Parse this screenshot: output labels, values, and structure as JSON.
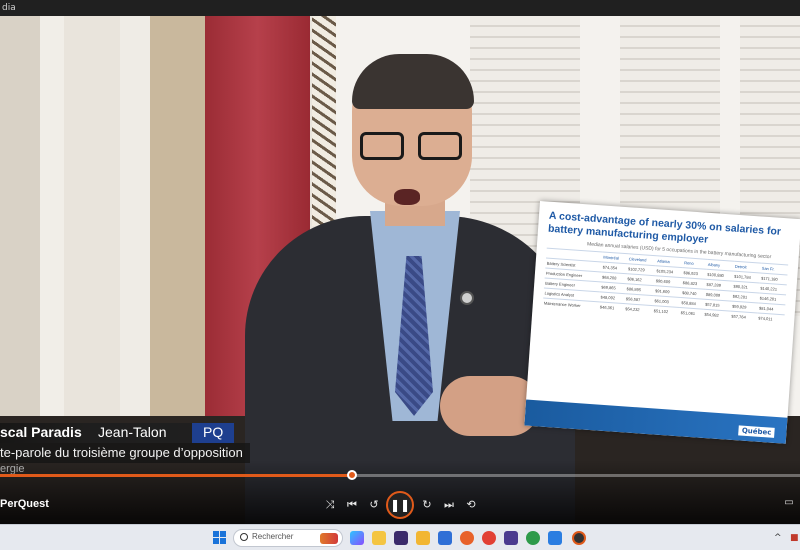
{
  "window": {
    "title": "dia"
  },
  "lower_third": {
    "name": "scal Paradis",
    "riding": "Jean-Talon",
    "party": "PQ",
    "role": "te-parole du troisième groupe d’opposition",
    "extra": "ergie"
  },
  "document": {
    "title": "A cost-advantage of nearly 30% on salaries for battery manufacturing employer",
    "subtitle": "Median annual salaries (USD) for 5 occupations in the battery manufacturing sector",
    "headers": [
      "",
      "Montréal",
      "Cleveland",
      "Atlanta",
      "Reno",
      "Albany",
      "Detroit",
      "San Fr."
    ],
    "rows": [
      [
        "Battery Scientist",
        "$74,354",
        "$102,729",
        "$105,234",
        "$96,923",
        "$100,880",
        "$101,784",
        "$171,180"
      ],
      [
        "Production Engineer",
        "$68,208",
        "$86,162",
        "$90,609",
        "$86,823",
        "$87,289",
        "$90,321",
        "$140,221"
      ],
      [
        "Battery Engineer",
        "$69,865",
        "$86,895",
        "$91,609",
        "$88,740",
        "$89,009",
        "$92,281",
        "$146,201"
      ],
      [
        "Logistics Analyst",
        "$48,092",
        "$56,587",
        "$61,003",
        "$58,884",
        "$57,815",
        "$59,929",
        "$81,044"
      ],
      [
        "Maintenance Worker",
        "$46,361",
        "$54,232",
        "$51,102",
        "$51,061",
        "$54,982",
        "$57,764",
        "$74,011"
      ]
    ],
    "brand": "Québec"
  },
  "player": {
    "app_label": "PerQuest",
    "progress": 0.44
  },
  "taskbar": {
    "search_placeholder": "Rechercher"
  },
  "colors": {
    "accent": "#e05a1a",
    "party_blue": "#1e3f8f",
    "doc_blue": "#1f5aa6"
  }
}
